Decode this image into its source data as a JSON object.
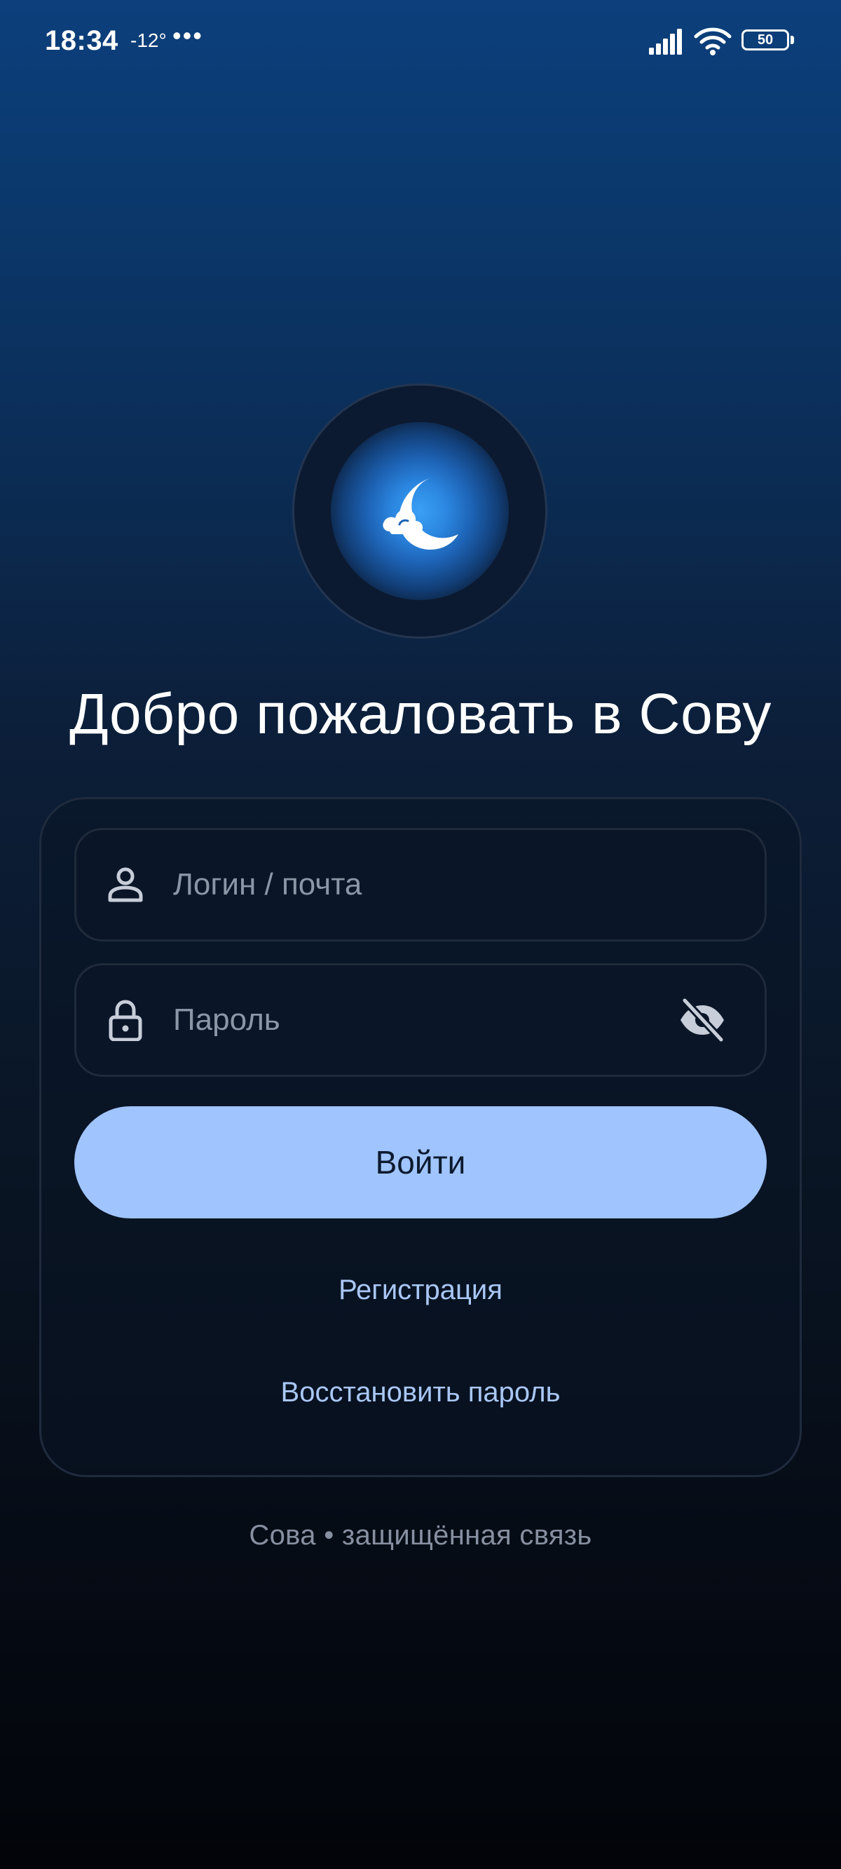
{
  "status_bar": {
    "time": "18:34",
    "temperature": "-12°",
    "more": "•••",
    "battery_level": "50"
  },
  "logo": {
    "icon": "moon-cloud-icon"
  },
  "title": "Добро пожаловать в Сову",
  "form": {
    "login_placeholder": "Логин / почта",
    "login_value": "",
    "password_placeholder": "Пароль",
    "password_value": "",
    "login_icon": "user-icon",
    "password_icon": "lock-icon",
    "visibility_icon": "eye-off-icon",
    "submit_label": "Войти",
    "register_label": "Регистрация",
    "restore_label": "Восстановить пароль"
  },
  "footer": "Сова • защищённая связь",
  "colors": {
    "button_bg": "#a0c4fd",
    "link": "#a9c7f5",
    "glow": "#3aa0f5"
  }
}
